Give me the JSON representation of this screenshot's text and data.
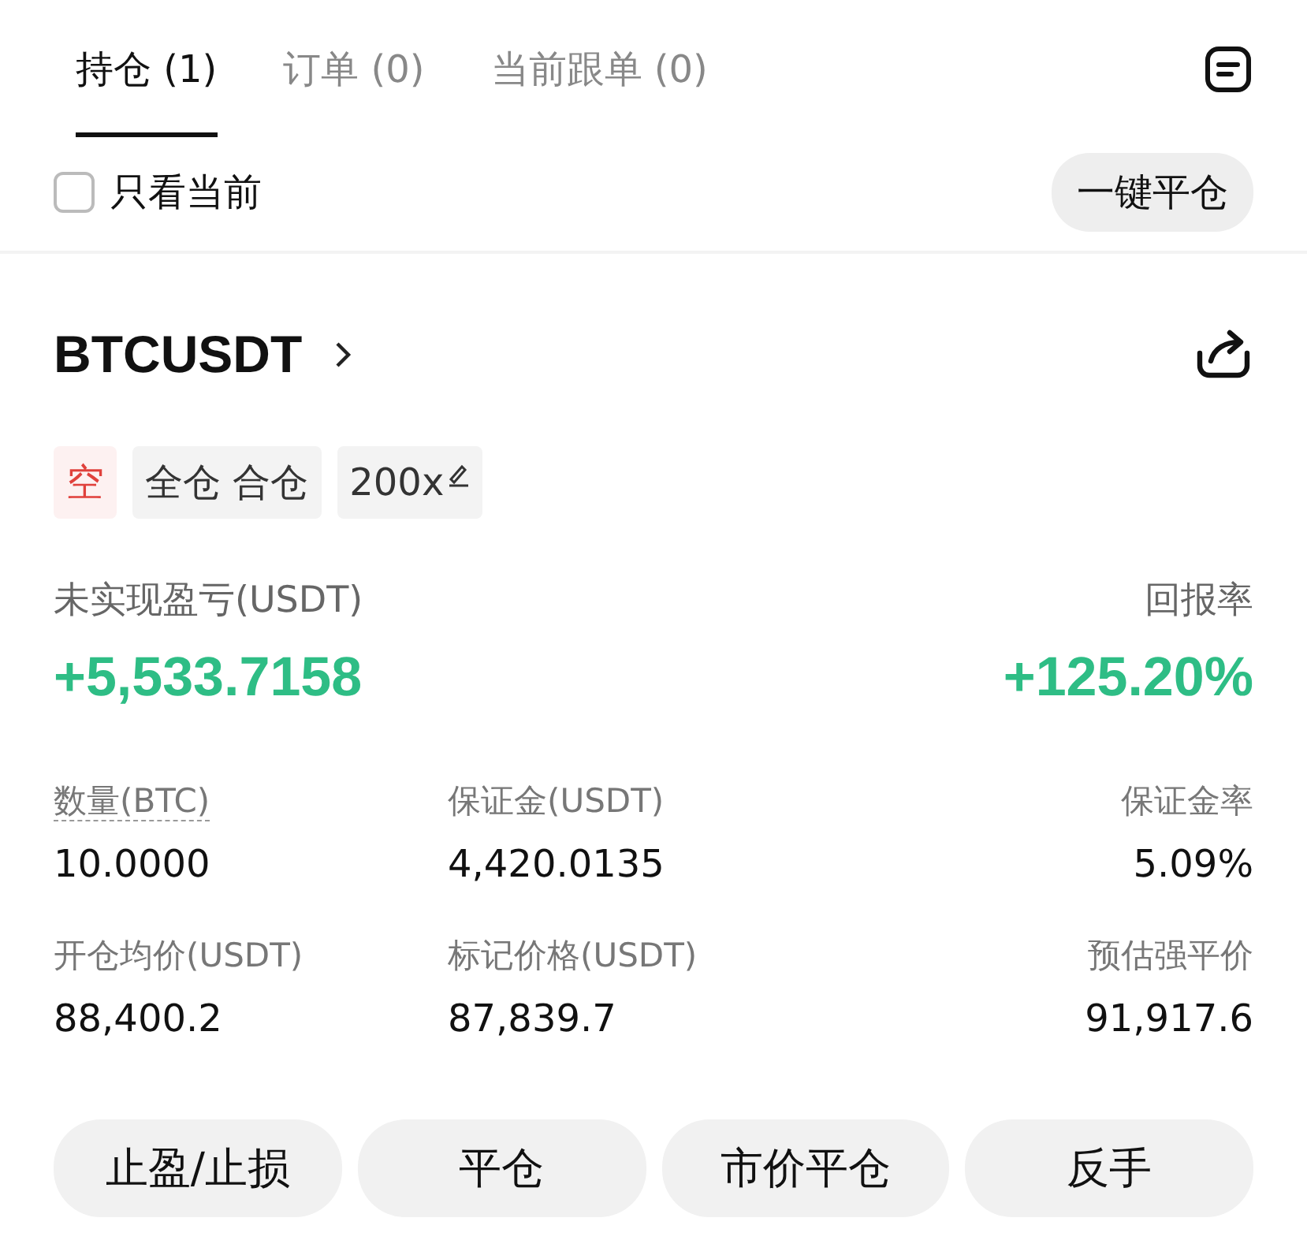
{
  "tabs": [
    {
      "label": "持仓 (1)",
      "selected": true
    },
    {
      "label": "订单 (0)",
      "selected": false
    },
    {
      "label": "当前跟单 (0)",
      "selected": false
    }
  ],
  "filter": {
    "label": "只看当前",
    "checked": false
  },
  "close_all_button": "一键平仓",
  "position": {
    "symbol": "BTCUSDT",
    "tags": [
      {
        "kind": "side",
        "label": "空"
      },
      {
        "kind": "plain",
        "label": "全仓 合仓"
      },
      {
        "kind": "leverage",
        "label": "200x"
      }
    ],
    "pnl": {
      "label": "未实现盈亏(USDT)",
      "value": "+5,533.7158"
    },
    "roe": {
      "label": "回报率",
      "value": "+125.20%"
    },
    "stats": [
      {
        "label": "数量(BTC)",
        "value": "10.0000",
        "underlined": true
      },
      {
        "label": "保证金(USDT)",
        "value": "4,420.0135",
        "underlined": false
      },
      {
        "label": "保证金率",
        "value": "5.09%",
        "underlined": false
      },
      {
        "label": "开仓均价(USDT)",
        "value": "88,400.2",
        "underlined": false
      },
      {
        "label": "标记价格(USDT)",
        "value": "87,839.7",
        "underlined": false
      },
      {
        "label": "预估强平价",
        "value": "91,917.6",
        "underlined": false
      }
    ]
  },
  "actions": [
    "止盈/止损",
    "平仓",
    "市价平仓",
    "反手"
  ]
}
